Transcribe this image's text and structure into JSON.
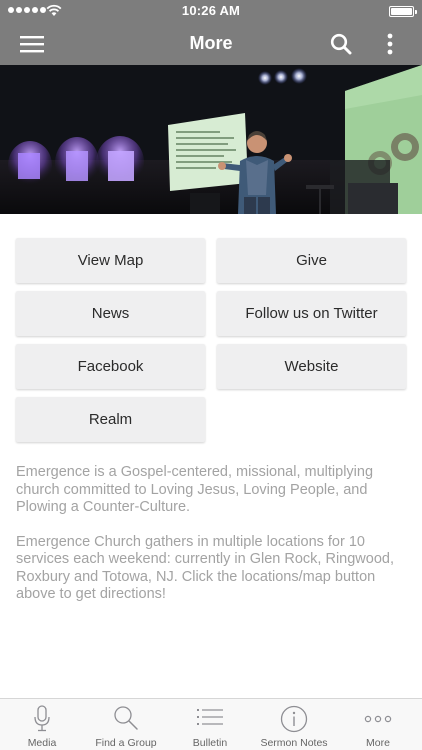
{
  "status_bar": {
    "time": "10:26 AM"
  },
  "nav": {
    "title": "More",
    "icons": [
      "menu-icon",
      "search-icon",
      "more-vertical-icon"
    ]
  },
  "hero": {
    "image_subject": "preacher-on-stage-photo"
  },
  "buttons": [
    {
      "label": "View Map"
    },
    {
      "label": "Give"
    },
    {
      "label": "News"
    },
    {
      "label": "Follow us on Twitter"
    },
    {
      "label": "Facebook"
    },
    {
      "label": "Website"
    },
    {
      "label": "Realm"
    }
  ],
  "about": {
    "paragraph_1": "Emergence is a Gospel-centered, missional, multiplying church committed to Loving Jesus, Loving People, and Plowing a Counter-Culture.",
    "paragraph_2": "Emergence Church gathers in multiple locations for 10 services each weekend: currently in Glen Rock, Ringwood, Roxbury and Totowa, NJ. Click the locations/map button above to get directions!"
  },
  "tabs": [
    {
      "label": "Media",
      "icon": "microphone-icon"
    },
    {
      "label": "Find a Group",
      "icon": "search-icon"
    },
    {
      "label": "Bulletin",
      "icon": "list-icon"
    },
    {
      "label": "Sermon Notes",
      "icon": "info-icon"
    },
    {
      "label": "More",
      "icon": "more-horizontal-icon"
    }
  ],
  "colors": {
    "bar_background": "#7d7d7d",
    "button_background": "#efeff0",
    "description_text": "#a3a3a3",
    "tab_bar_background": "#f8f8f8"
  }
}
